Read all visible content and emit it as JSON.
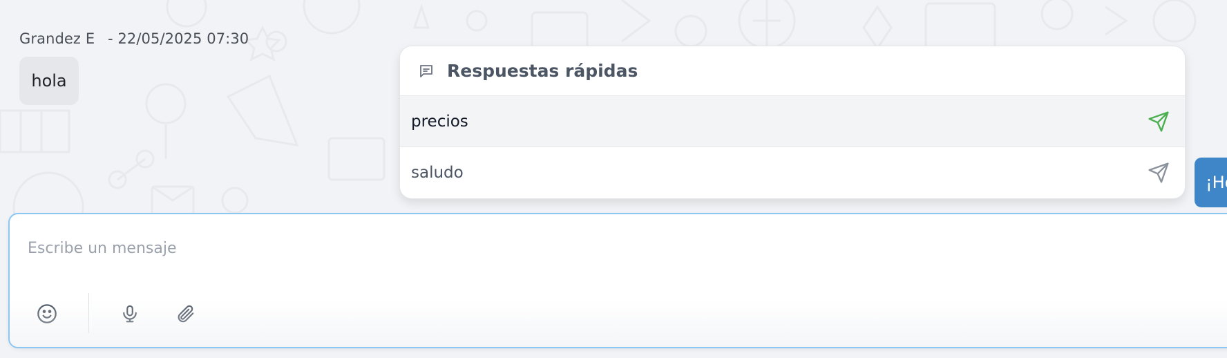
{
  "message_in": {
    "sender": "Grandez E",
    "date": "- 22/05/2025 07:30",
    "text": "hola"
  },
  "message_out": {
    "text": "¡Ho"
  },
  "quick_replies": {
    "title": "Respuestas rápidas",
    "header_icon": "message-square-icon",
    "items": [
      {
        "label": "precios",
        "active": true,
        "send_icon": "send-icon",
        "send_color": "#4caf50"
      },
      {
        "label": "saludo",
        "active": false,
        "send_icon": "send-icon",
        "send_color": "#8b929c"
      }
    ]
  },
  "composer": {
    "placeholder": "Escribe un mensaje",
    "value": "",
    "tools": [
      {
        "name": "emoji-icon"
      },
      {
        "name": "microphone-icon"
      },
      {
        "name": "paperclip-icon"
      }
    ],
    "focus_border_color": "#8cc6f2"
  },
  "colors": {
    "background": "#f1f3f6",
    "incoming_bubble": "#e6e7ea",
    "outgoing_bubble": "#3f86c9",
    "active_send": "#4caf50"
  }
}
